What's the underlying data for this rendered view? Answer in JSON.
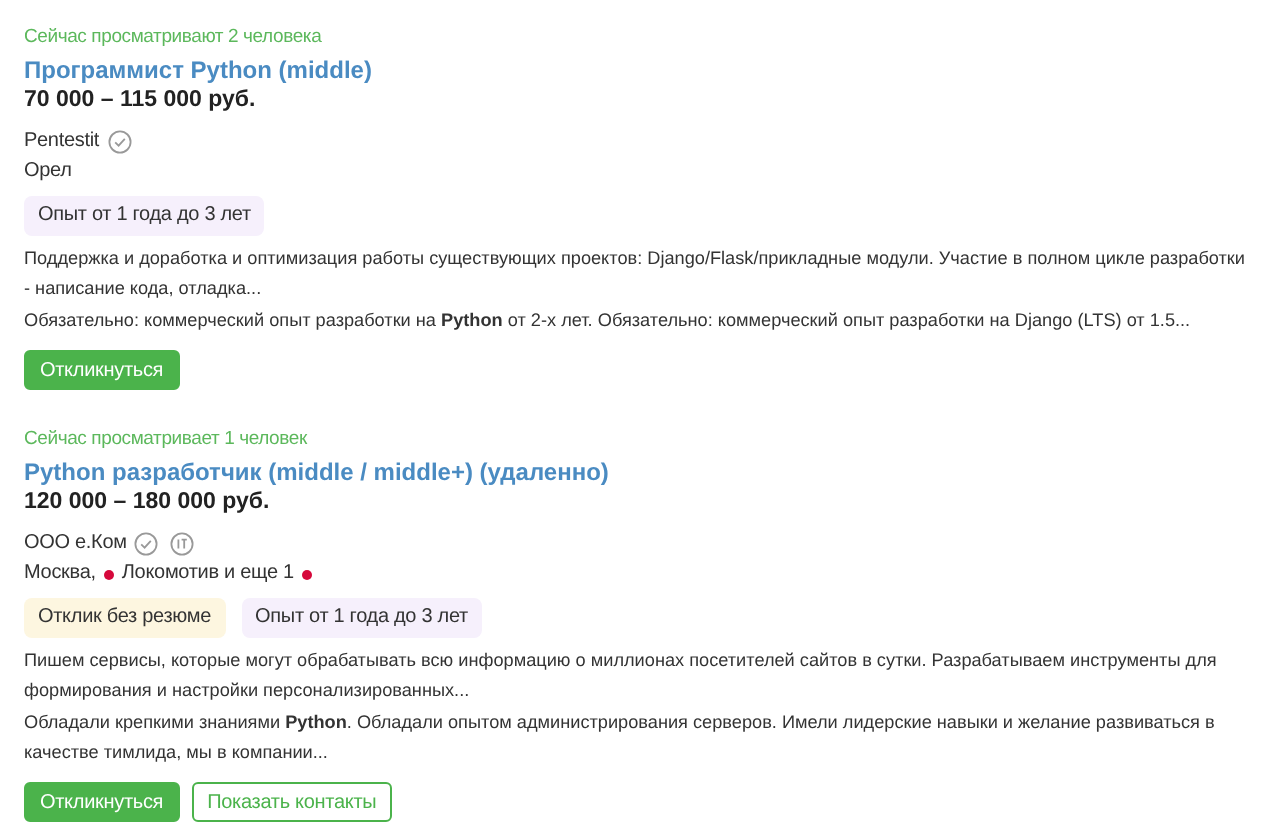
{
  "vacancies": [
    {
      "viewers": "Сейчас просматривают 2 человека",
      "title": "Программист Python (middle)",
      "salary": "70 000 – 115 000 руб.",
      "company": "Pentestit",
      "verified": true,
      "city": "Орел",
      "tags": [
        {
          "kind": "experience",
          "text": "Опыт от 1 года до 3 лет"
        }
      ],
      "paragraphs": [
        "Поддержка и доработка и оптимизация работы существующих проектов: Django/Flask/прикладные модули. Участие в полном цикле разработки - написание кода, отладка...",
        "Обязательно: коммерческий опыт разработки на **Python** от 2-х лет. Обязательно: коммерческий опыт разработки на Django (LTS) от 1.5..."
      ],
      "buttons": [
        {
          "kind": "primary",
          "label": "Откликнуться"
        }
      ]
    },
    {
      "viewers": "Сейчас просматривает 1 человек",
      "title": "Python разработчик (middle / middle+) (удаленно)",
      "salary": "120 000 – 180 000 руб.",
      "company": "ООО е.Ком",
      "verified": true,
      "it_accredited": true,
      "city": "Москва,",
      "metro": {
        "station": "Локомотив и еще 1",
        "color": "#d6083b"
      },
      "tags": [
        {
          "kind": "no-resume",
          "text": "Отклик без резюме"
        },
        {
          "kind": "experience",
          "text": "Опыт от 1 года до 3 лет"
        }
      ],
      "paragraphs": [
        "Пишем сервисы, которые могут обрабатывать всю информацию о миллионах посетителей сайтов в сутки. Разрабатываем инструменты для формирования и настройки персонализированных...",
        "Обладали крепкими знаниями **Python**. Обладали опытом администрирования серверов. Имели лидерские навыки и желание развиваться в качестве тимлида, мы в компании..."
      ],
      "buttons": [
        {
          "kind": "primary",
          "label": "Откликнуться"
        },
        {
          "kind": "outline",
          "label": "Показать контакты"
        }
      ]
    }
  ]
}
